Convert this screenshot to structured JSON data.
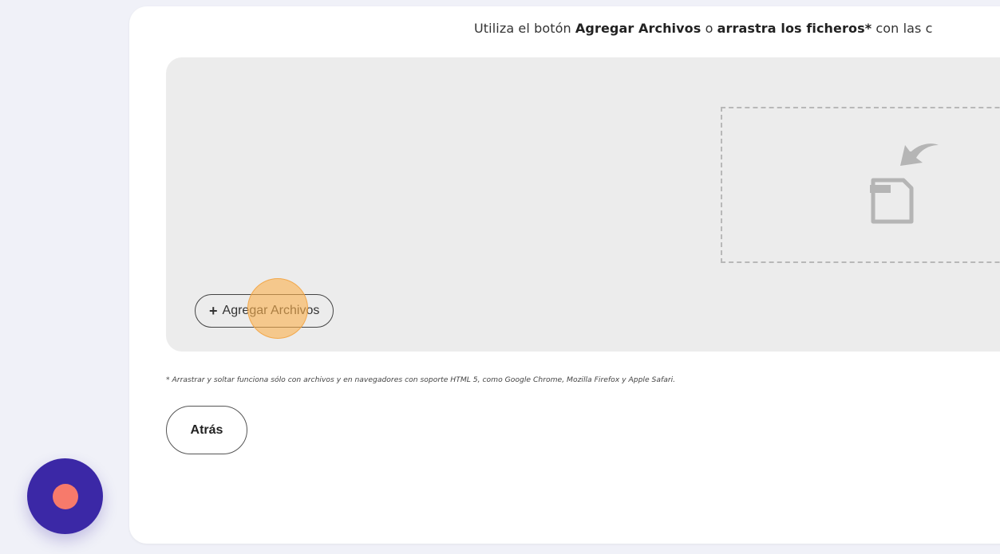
{
  "instructions": {
    "part1": "Utiliza el botón ",
    "bold1": "Agregar Archivos",
    "part2": " o ",
    "bold2": "arrastra los ficheros*",
    "part3": " con las c"
  },
  "uploader": {
    "add_button_plus": "+",
    "add_button_label": "Agregar Archivos",
    "drop_icon": "file-drop-icon"
  },
  "footnote": "* Arrastrar y soltar funciona sólo con archivos y en navegadores con soporte HTML 5, como Google Chrome, Mozilla Firefox y Apple Safari.",
  "back_button_label": "Atrás",
  "recorder": {
    "icon": "record-icon",
    "dot_color": "#f77a6b",
    "button_color": "#3b28a6"
  },
  "colors": {
    "click_highlight": "#fbb14c"
  }
}
